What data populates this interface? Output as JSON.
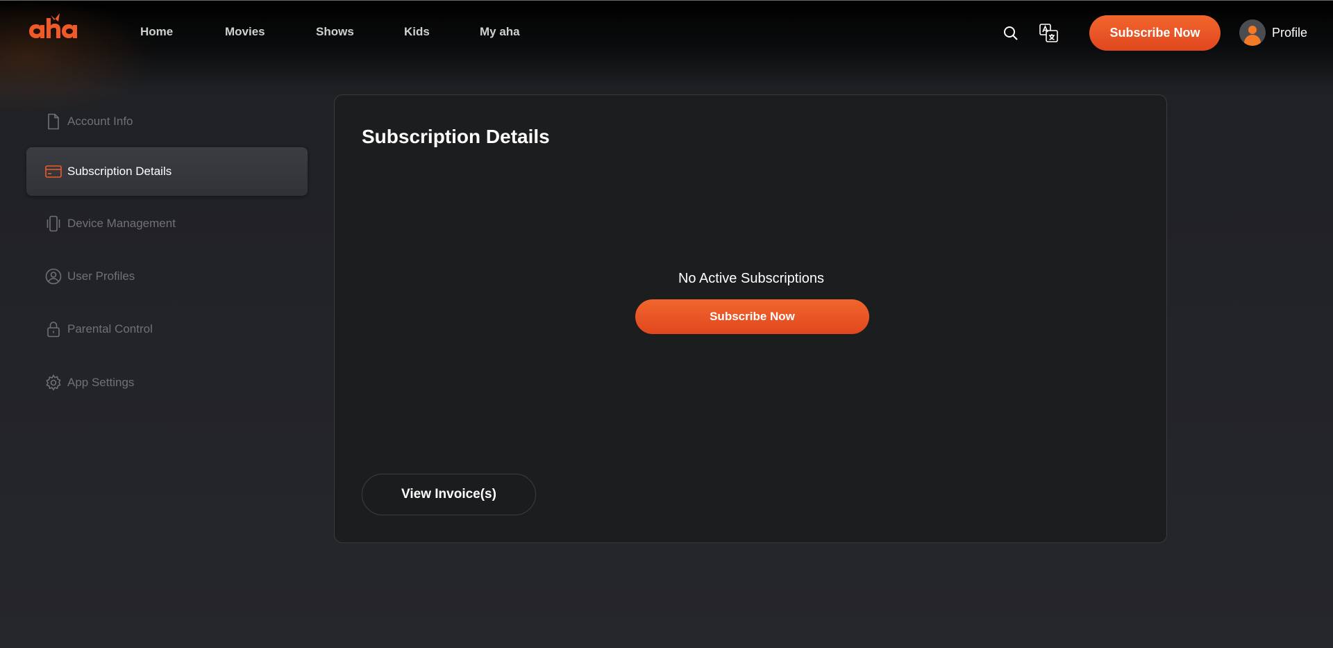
{
  "brand": {
    "logo_text": "aha",
    "accent": "#f05a28"
  },
  "nav": {
    "items": [
      {
        "label": "Home"
      },
      {
        "label": "Movies"
      },
      {
        "label": "Shows"
      },
      {
        "label": "Kids"
      },
      {
        "label": "My aha"
      }
    ]
  },
  "header": {
    "search_icon": "search-icon",
    "language_icon": "translate-icon",
    "subscribe_label": "Subscribe Now",
    "profile_label": "Profile"
  },
  "sidebar": {
    "items": [
      {
        "label": "Account Info",
        "icon": "document-icon",
        "active": false
      },
      {
        "label": "Subscription Details",
        "icon": "card-icon",
        "active": true
      },
      {
        "label": "Device Management",
        "icon": "device-icon",
        "active": false
      },
      {
        "label": "User Profiles",
        "icon": "user-circle-icon",
        "active": false
      },
      {
        "label": "Parental Control",
        "icon": "lock-icon",
        "active": false
      },
      {
        "label": "App Settings",
        "icon": "gear-icon",
        "active": false
      }
    ]
  },
  "main": {
    "title": "Subscription Details",
    "empty_message": "No Active Subscriptions",
    "subscribe_label": "Subscribe Now",
    "invoice_label": "View Invoice(s)"
  }
}
